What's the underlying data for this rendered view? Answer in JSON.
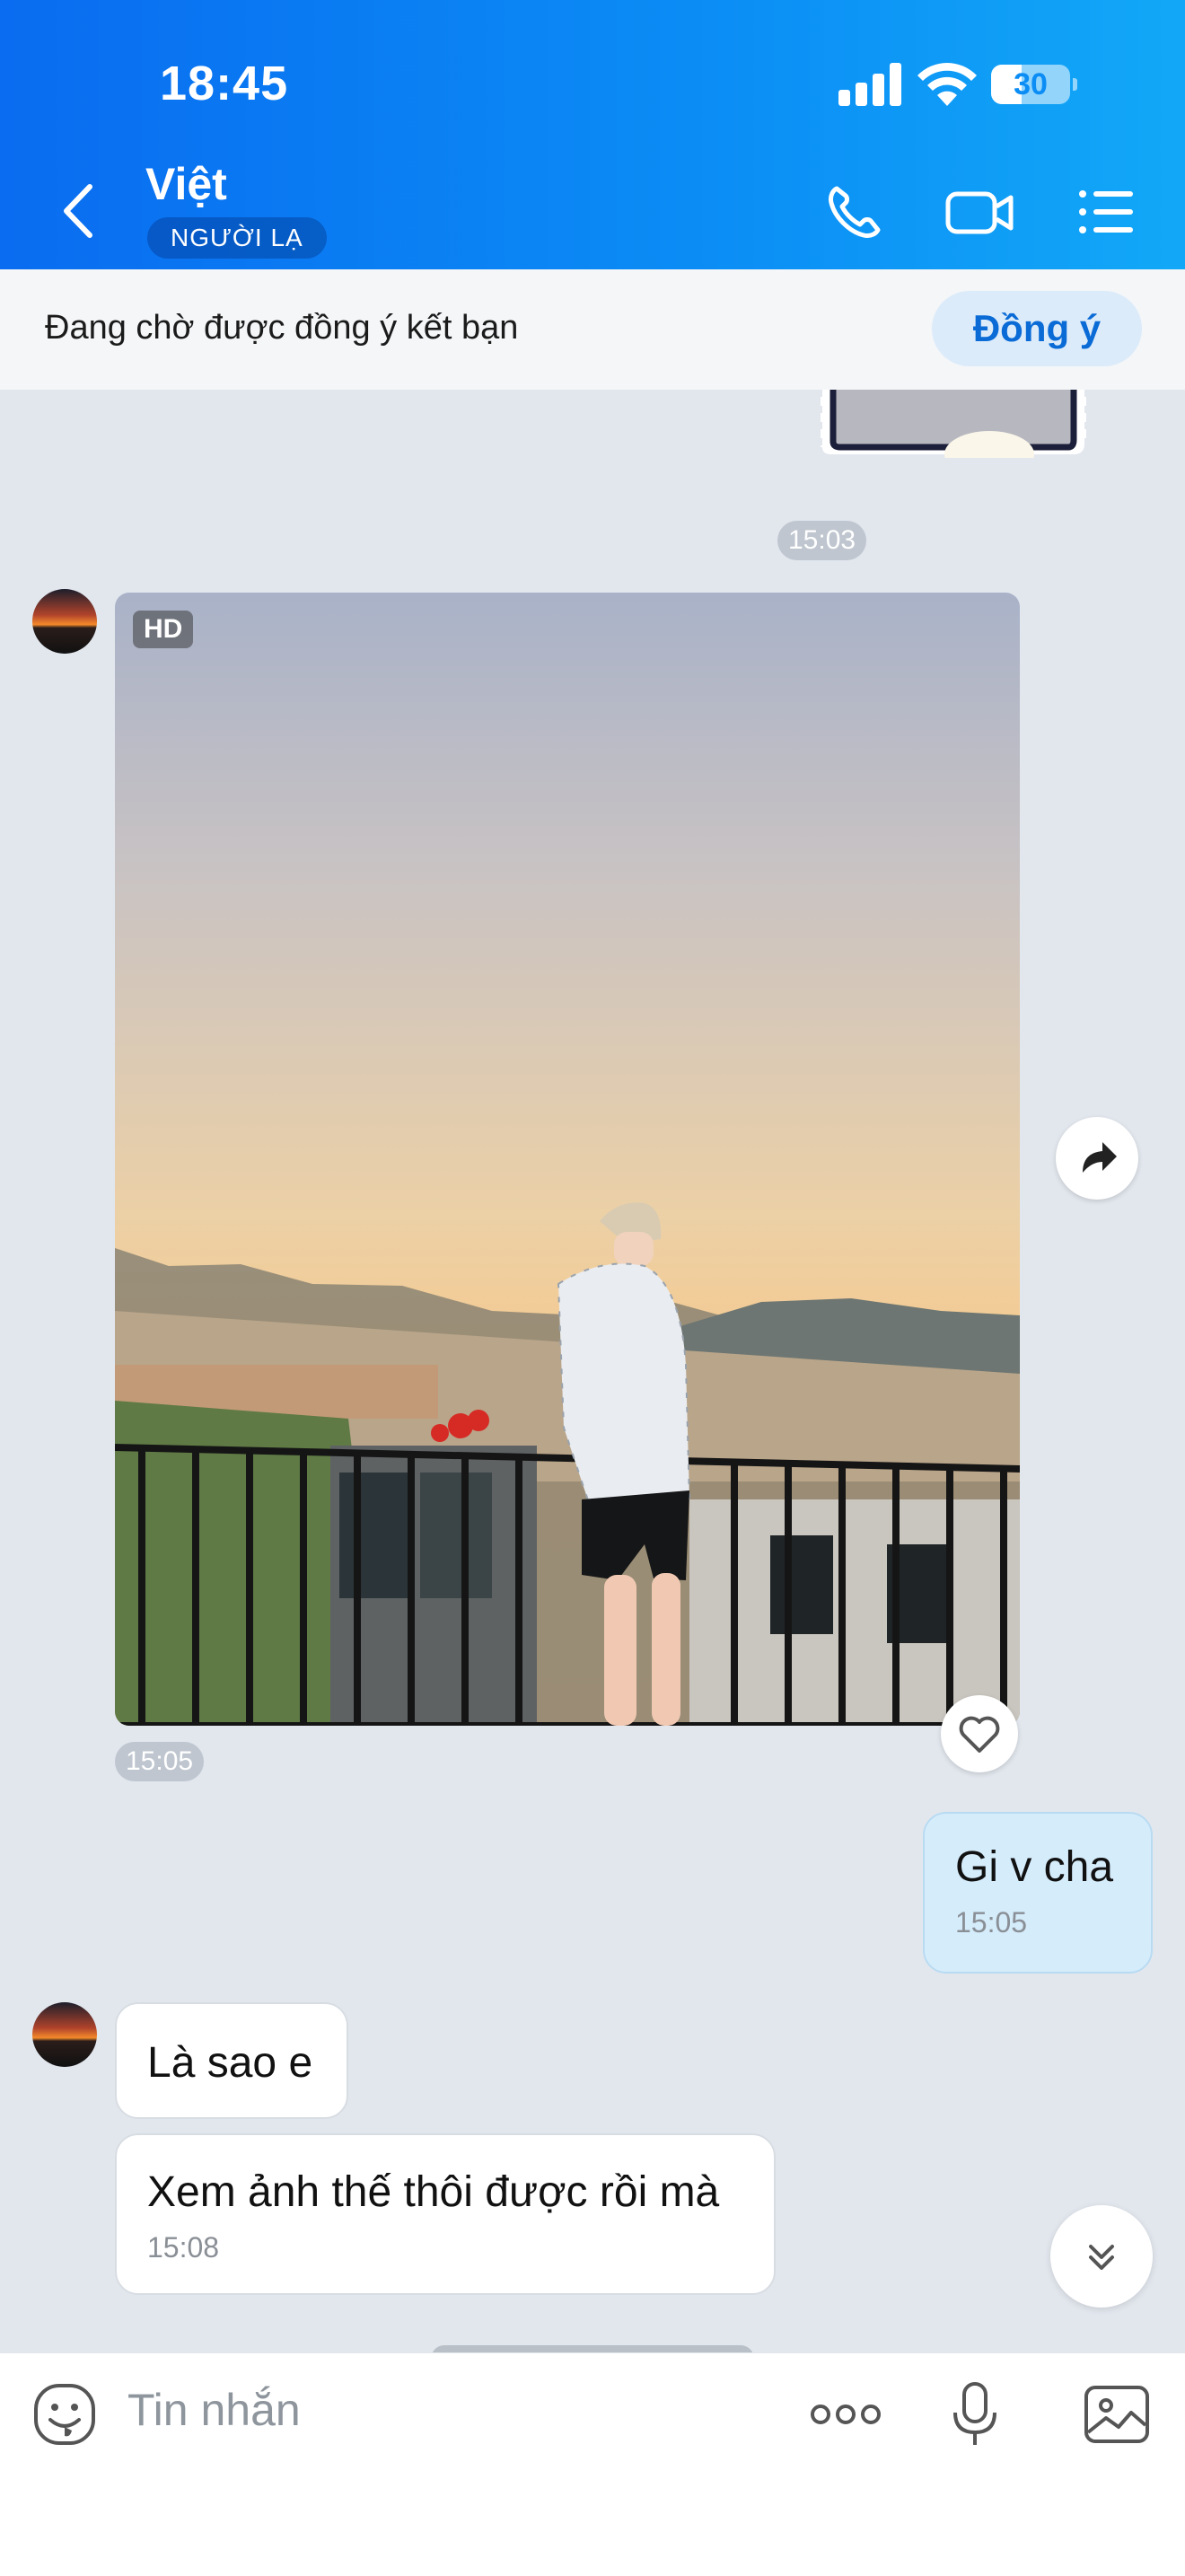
{
  "status_bar": {
    "time": "18:45",
    "battery": "30"
  },
  "header": {
    "title": "Việt",
    "badge": "NGƯỜI LẠ"
  },
  "friend_request": {
    "text": "Đang chờ được đồng ý kết bạn",
    "accept_label": "Đồng ý"
  },
  "messages": {
    "time_divider": "15:03",
    "photo": {
      "quality_badge": "HD",
      "time": "15:05"
    },
    "outgoing": {
      "text": "Gi v cha",
      "time": "15:05"
    },
    "incoming_1": {
      "text": "Là sao e"
    },
    "incoming_2": {
      "text": "Xem ảnh thế thôi được rồi mà",
      "time": "15:08"
    }
  },
  "composer": {
    "placeholder": "Tin nhắn"
  },
  "colors": {
    "header_start": "#0a6cf0",
    "header_end": "#12a8f7",
    "accent": "#0a6bd6",
    "outgoing_bubble": "#d5ecfb",
    "chat_background": "#e2e7ee"
  }
}
